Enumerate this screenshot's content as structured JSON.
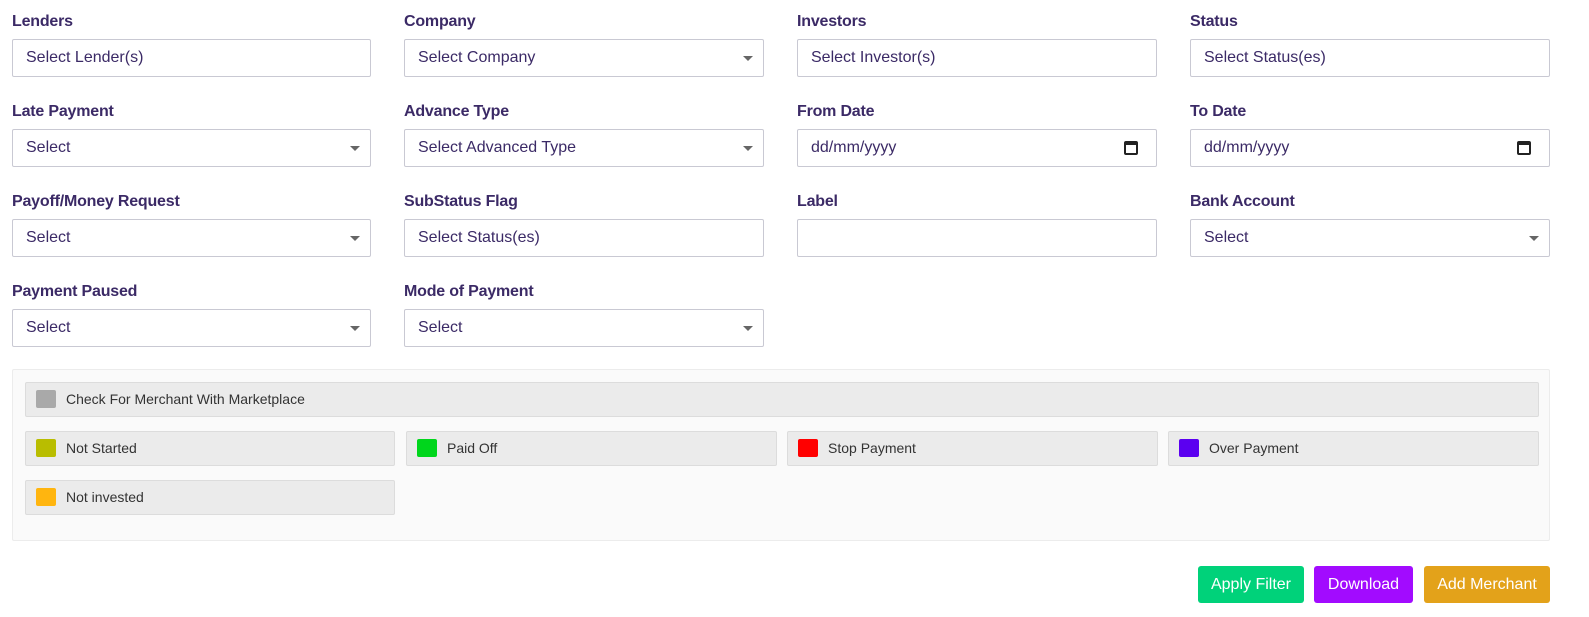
{
  "filters": {
    "lenders": {
      "label": "Lenders",
      "value": "Select Lender(s)"
    },
    "company": {
      "label": "Company",
      "value": "Select Company"
    },
    "investors": {
      "label": "Investors",
      "value": "Select Investor(s)"
    },
    "status": {
      "label": "Status",
      "value": "Select Status(es)"
    },
    "late_payment": {
      "label": "Late Payment",
      "value": "Select"
    },
    "advance_type": {
      "label": "Advance Type",
      "value": "Select Advanced Type"
    },
    "from_date": {
      "label": "From Date",
      "value": "dd/mm/yyyy"
    },
    "to_date": {
      "label": "To Date",
      "value": "dd/mm/yyyy"
    },
    "payoff_request": {
      "label": "Payoff/Money Request",
      "value": "Select"
    },
    "substatus_flag": {
      "label": "SubStatus Flag",
      "value": "Select Status(es)"
    },
    "label": {
      "label": "Label",
      "value": ""
    },
    "bank_account": {
      "label": "Bank Account",
      "value": "Select"
    },
    "payment_paused": {
      "label": "Payment Paused",
      "value": "Select"
    },
    "mode_of_payment": {
      "label": "Mode of Payment",
      "value": "Select"
    }
  },
  "legend": {
    "marketplace": {
      "label": "Check For Merchant With Marketplace",
      "color": "#a9a9a9"
    },
    "not_started": {
      "label": "Not Started",
      "color": "#b9bd00"
    },
    "paid_off": {
      "label": "Paid Off",
      "color": "#00d61c"
    },
    "stop_payment": {
      "label": "Stop Payment",
      "color": "#ff0000"
    },
    "over_payment": {
      "label": "Over Payment",
      "color": "#5b00f0"
    },
    "not_invested": {
      "label": "Not invested",
      "color": "#ffb50f"
    }
  },
  "buttons": {
    "apply_filter": {
      "label": "Apply Filter",
      "color": "#00d27a"
    },
    "download": {
      "label": "Download",
      "color": "#a20bff"
    },
    "add_merchant": {
      "label": "Add Merchant",
      "color": "#e3a21a"
    }
  }
}
